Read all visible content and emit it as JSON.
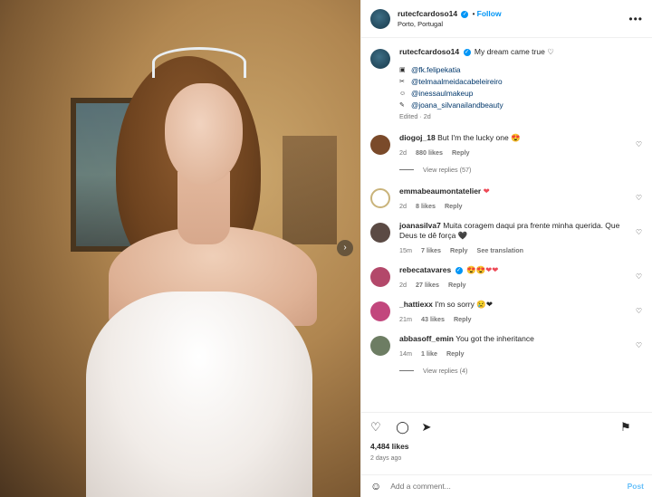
{
  "photo": {
    "alt_icon": "chevron-right-icon",
    "next_glyph": "›"
  },
  "post": {
    "username": "rutecfcardoso14",
    "verified_glyph": "✓",
    "separator": "•",
    "follow_label": "Follow",
    "location": "Porto, Portugal",
    "more_glyph": "•••"
  },
  "caption": {
    "username": "rutecfcardoso14",
    "text": "My dream came true ♡",
    "credits": [
      {
        "icon_glyph": "▣",
        "handle": "@fk.felipekatia"
      },
      {
        "icon_glyph": "✂",
        "handle": "@telmaalmeidacabeleireiro"
      },
      {
        "icon_glyph": "☺",
        "handle": "@inessaulmakeup"
      },
      {
        "icon_glyph": "✎",
        "handle": "@joana_silvanailandbeauty"
      }
    ],
    "edited": "Edited · 2d"
  },
  "comments": [
    {
      "username": "diogoj_18",
      "text": "But I'm the lucky one 😍",
      "time": "2d",
      "likes": "880 likes",
      "reply": "Reply",
      "view_replies": "View replies (57)",
      "avatar_color": "#7a4a2a"
    },
    {
      "username": "emmabeaumontatelier",
      "text": "❤",
      "time": "2d",
      "likes": "8 likes",
      "reply": "Reply",
      "avatar_color": "#c9b37a"
    },
    {
      "username": "joanasilva7",
      "text": "Muita coragem daqui pra frente minha querida. Que Deus te dê força 🖤",
      "time": "15m",
      "likes": "7 likes",
      "reply": "Reply",
      "extra": "See translation",
      "avatar_color": "#5b4a44"
    },
    {
      "username": "rebecatavares",
      "text": "😍😍❤❤",
      "time": "2d",
      "likes": "27 likes",
      "reply": "Reply",
      "avatar_color": "#b3486a"
    },
    {
      "username": "_hattiexx",
      "text": "I'm so sorry 😢❤",
      "time": "21m",
      "likes": "43 likes",
      "reply": "Reply",
      "avatar_color": "#c2477d"
    },
    {
      "username": "abbasoff_emin",
      "text": "You got the inheritance",
      "time": "14m",
      "likes": "1 like",
      "reply": "Reply",
      "view_replies": "View replies (4)",
      "avatar_color": "#6d7d63"
    }
  ],
  "actions": {
    "like_icon": "♡",
    "comment_icon": "◯",
    "share_icon": "➤",
    "save_icon": "⚑"
  },
  "likes": "4,484 likes",
  "time_ago": "2 days ago",
  "add_comment": {
    "emoji_glyph": "☺",
    "placeholder": "Add a comment...",
    "post_label": "Post"
  }
}
